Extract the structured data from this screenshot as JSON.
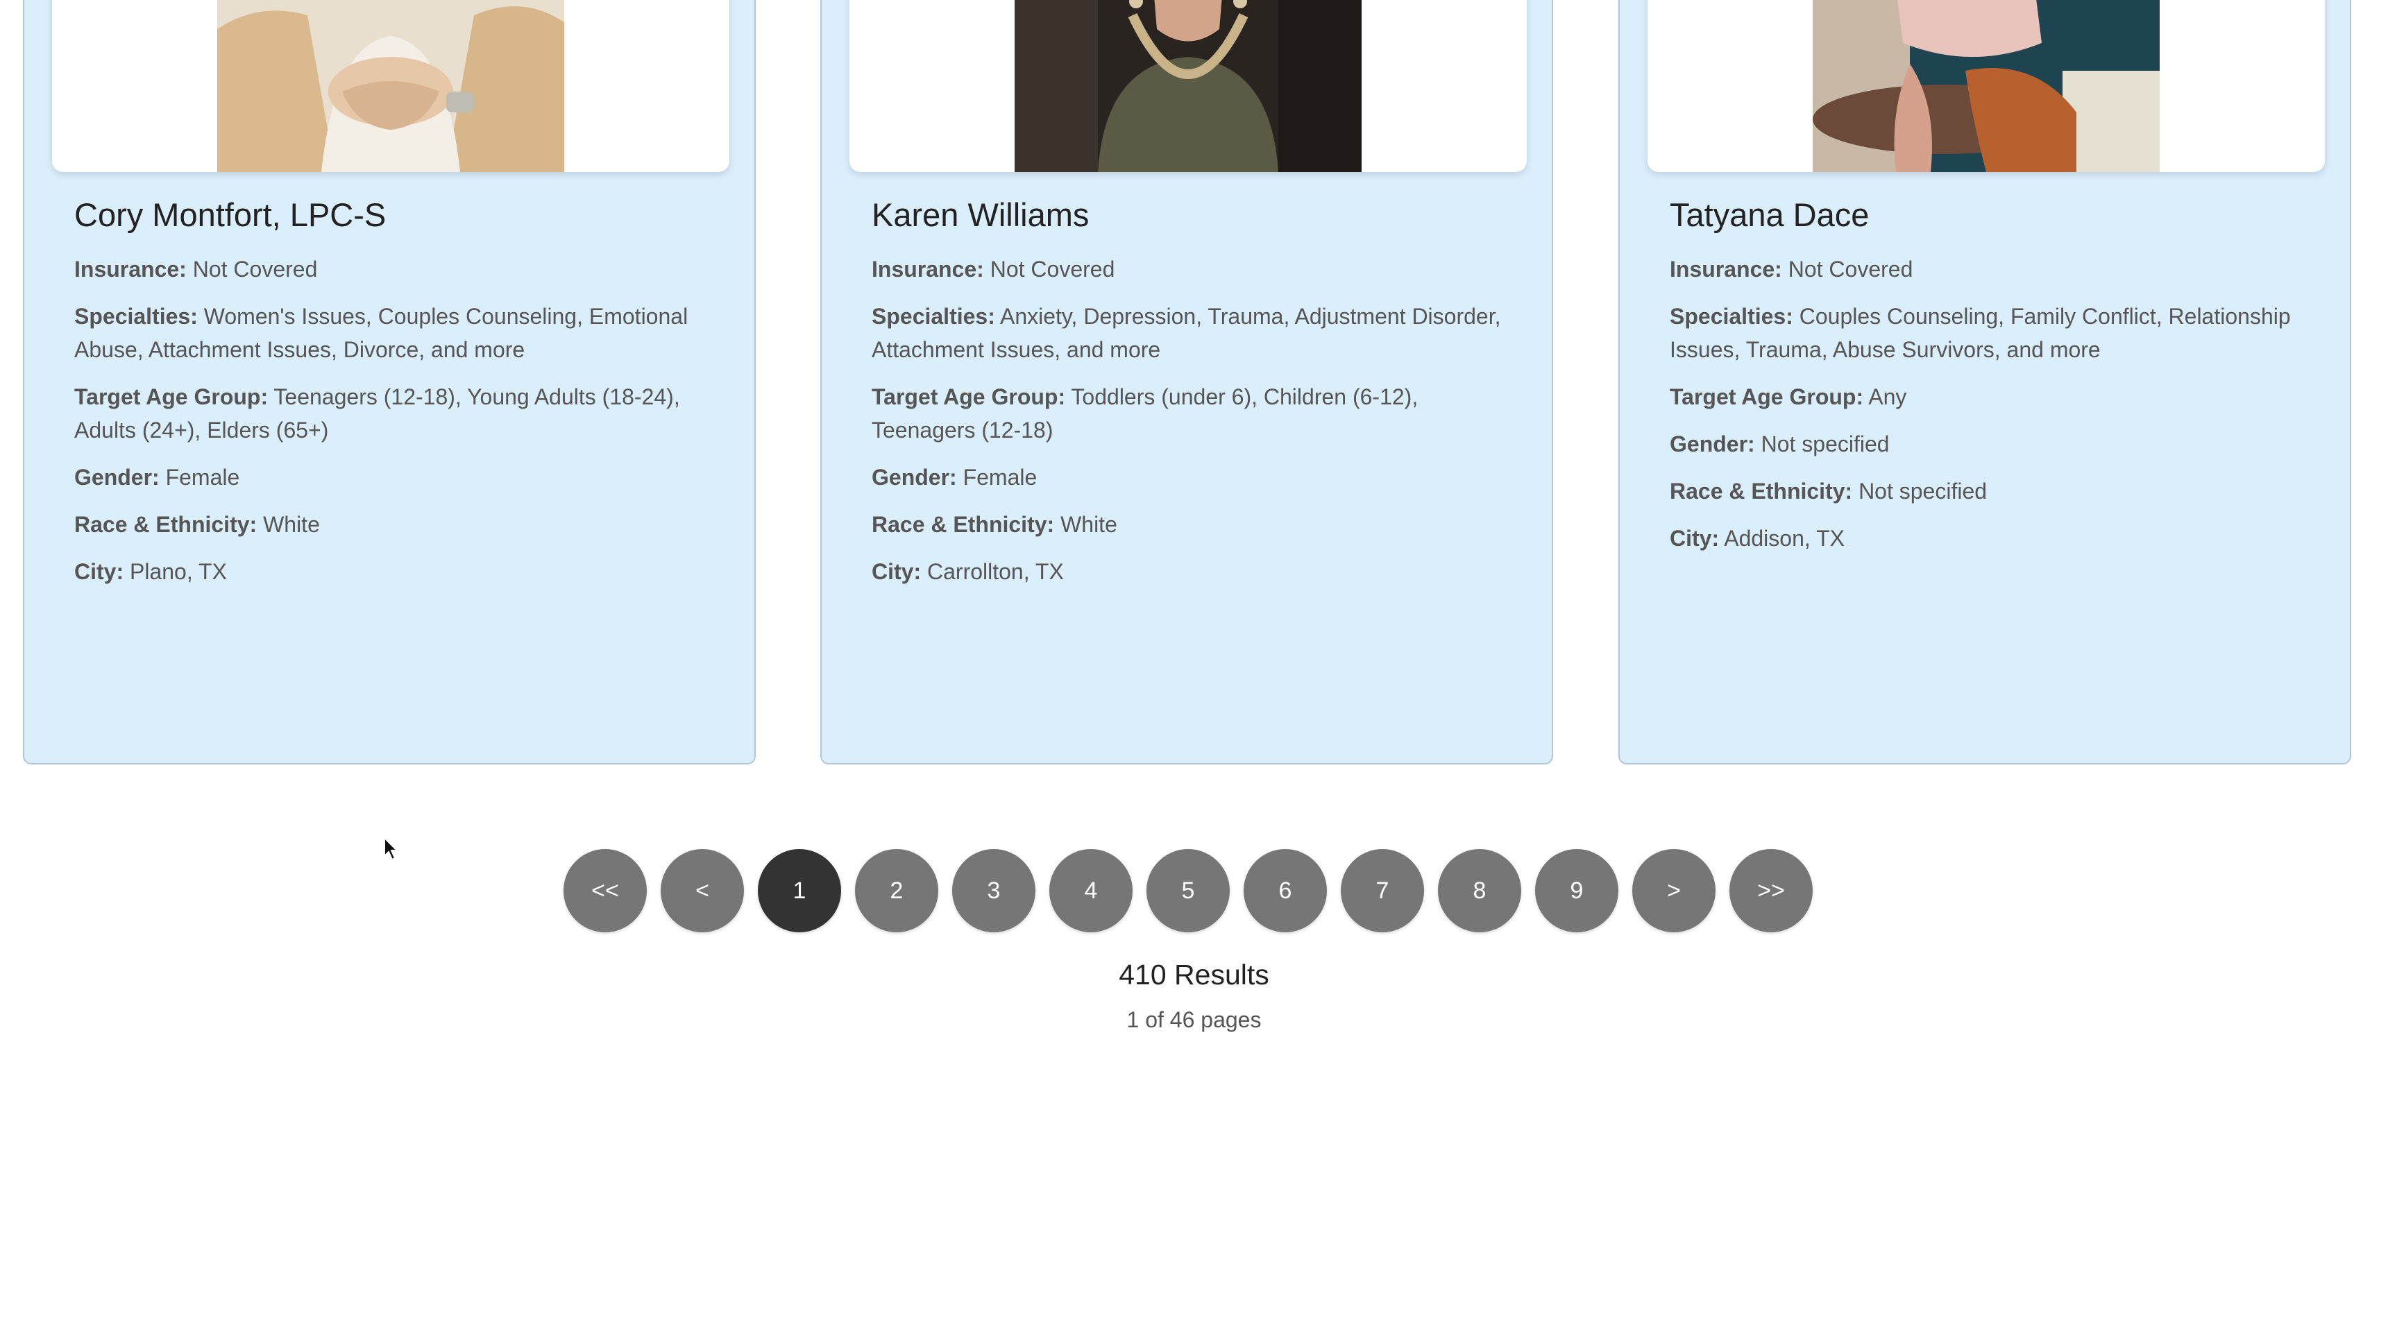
{
  "cards": [
    {
      "name": "Cory Montfort, LPC-S",
      "insurance_label": "Insurance:",
      "insurance": "Not Covered",
      "specialties_label": "Specialties:",
      "specialties": "Women's Issues, Couples Counseling, Emotional Abuse, Attachment Issues, Divorce, and more",
      "age_label": "Target Age Group:",
      "age": "Teenagers (12-18), Young Adults (18-24), Adults (24+), Elders (65+)",
      "gender_label": "Gender:",
      "gender": "Female",
      "race_label": "Race & Ethnicity:",
      "race": "White",
      "city_label": "City:",
      "city": "Plano, TX"
    },
    {
      "name": "Karen Williams",
      "insurance_label": "Insurance:",
      "insurance": "Not Covered",
      "specialties_label": "Specialties:",
      "specialties": "Anxiety, Depression, Trauma, Adjustment Disorder, Attachment Issues, and more",
      "age_label": "Target Age Group:",
      "age": "Toddlers (under 6), Children (6-12), Teenagers (12-18)",
      "gender_label": "Gender:",
      "gender": "Female",
      "race_label": "Race & Ethnicity:",
      "race": "White",
      "city_label": "City:",
      "city": "Carrollton, TX"
    },
    {
      "name": "Tatyana Dace",
      "insurance_label": "Insurance:",
      "insurance": "Not Covered",
      "specialties_label": "Specialties:",
      "specialties": "Couples Counseling, Family Conflict, Relationship Issues, Trauma, Abuse Survivors, and more",
      "age_label": "Target Age Group:",
      "age": "Any",
      "gender_label": "Gender:",
      "gender": "Not specified",
      "race_label": "Race & Ethnicity:",
      "race": "Not specified",
      "city_label": "City:",
      "city": "Addison, TX"
    }
  ],
  "pagination": {
    "first": "<<",
    "prev": "<",
    "pages": [
      "1",
      "2",
      "3",
      "4",
      "5",
      "6",
      "7",
      "8",
      "9"
    ],
    "current": "1",
    "next": ">",
    "last": ">>"
  },
  "summary": {
    "results": "410 Results",
    "pages_info": "1 of 46 pages"
  },
  "colors": {
    "card_bg": "#dbeefb",
    "card_border": "#b4c6d4",
    "page_button": "#767676",
    "page_button_active": "#333333"
  }
}
